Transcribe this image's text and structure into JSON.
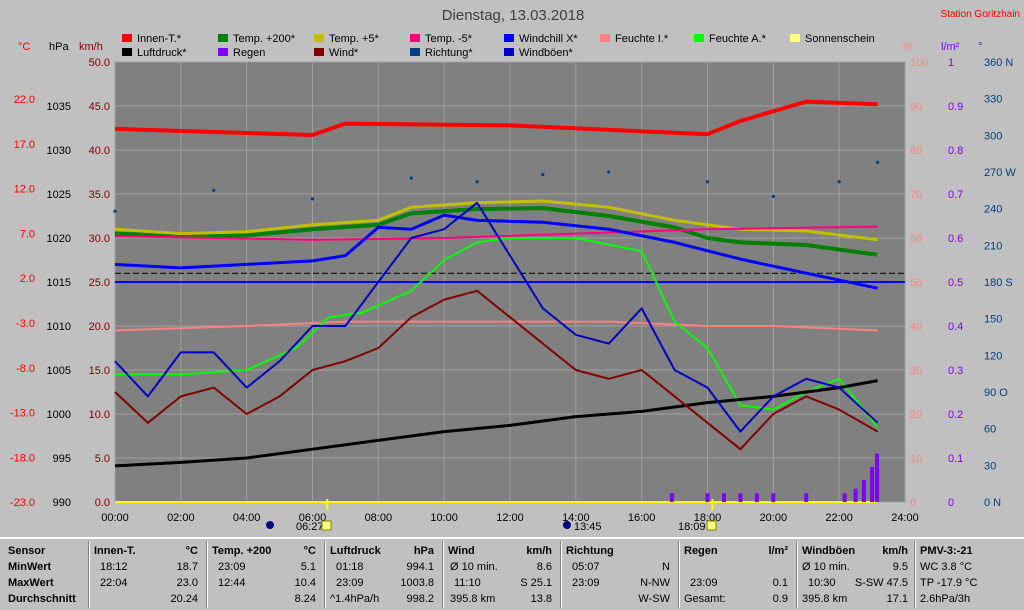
{
  "header": {
    "title": "Dienstag, 13.03.2018",
    "station": "Station Goritzhain"
  },
  "legend": [
    {
      "label": "Innen-T.*",
      "color": "#ff0000"
    },
    {
      "label": "Temp. +200*",
      "color": "#008000"
    },
    {
      "label": "Temp. +5*",
      "color": "#c0c000"
    },
    {
      "label": "Temp. -5*",
      "color": "#ff0080"
    },
    {
      "label": "Windchill X*",
      "color": "#0000ff"
    },
    {
      "label": "Feuchte I.*",
      "color": "#ff8080"
    },
    {
      "label": "Feuchte A.*",
      "color": "#00ff00"
    },
    {
      "label": "Sonnenschein",
      "color": "#ffff80"
    },
    {
      "label": "Luftdruck*",
      "color": "#000000"
    },
    {
      "label": "Regen",
      "color": "#8000ff"
    },
    {
      "label": "Wind*",
      "color": "#800000"
    },
    {
      "label": "Richtung*",
      "color": "#004080"
    },
    {
      "label": "Windböen*",
      "color": "#0000c0"
    }
  ],
  "axes": {
    "celsius": {
      "unit": "°C",
      "ticks": [
        "22.0",
        "17.0",
        "12.0",
        "7.0",
        "2.0",
        "-3.0",
        "-8.0",
        "-13.0",
        "-18.0",
        "-23.0"
      ],
      "color": "#ff0000"
    },
    "hpa": {
      "unit": "hPa",
      "ticks": [
        "1035",
        "1030",
        "1025",
        "1020",
        "1015",
        "1010",
        "1005",
        "1000",
        "995",
        "990"
      ],
      "color": "#000000"
    },
    "kmh": {
      "unit": "km/h",
      "ticks": [
        "50.0",
        "45.0",
        "40.0",
        "35.0",
        "30.0",
        "25.0",
        "20.0",
        "15.0",
        "10.0",
        "5.0",
        "0.0"
      ],
      "color": "#800000"
    },
    "percent": {
      "unit": "%",
      "ticks": [
        "100",
        "90",
        "80",
        "70",
        "60",
        "50",
        "40",
        "30",
        "20",
        "10",
        "0"
      ],
      "color": "#ff8080"
    },
    "lm2": {
      "unit": "l/m²",
      "ticks": [
        "1",
        "0.9",
        "0.8",
        "0.7",
        "0.6",
        "0.5",
        "0.4",
        "0.3",
        "0.2",
        "0.1",
        "0"
      ],
      "color": "#8000ff"
    },
    "deg": {
      "unit": "°",
      "ticks": [
        "360 N",
        "330",
        "300",
        "270 W",
        "240",
        "210",
        "180 S",
        "150",
        "120",
        "90 O",
        "60",
        "30",
        "0 N"
      ],
      "color": "#004080"
    },
    "time": {
      "ticks": [
        "00:00",
        "02:00",
        "04:00",
        "06:00",
        "08:00",
        "10:00",
        "12:00",
        "14:00",
        "16:00",
        "18:00",
        "20:00",
        "22:00",
        "24:00"
      ]
    }
  },
  "sun_markers": {
    "sunrise_time": "06:27",
    "moon_time": "13:45",
    "sunset_time": "18:09"
  },
  "chart_data": {
    "type": "line",
    "title": "Dienstag, 13.03.2018",
    "x_label": "",
    "x_range": [
      "00:00",
      "24:00"
    ],
    "series": [
      {
        "name": "Innen-T.*",
        "axis": "°C",
        "x": [
          "00:00",
          "06:00",
          "07:00",
          "12:00",
          "18:00",
          "19:00",
          "21:00",
          "23:10"
        ],
        "values": [
          19.4,
          18.7,
          20.0,
          19.8,
          18.8,
          20.3,
          22.5,
          22.2
        ]
      },
      {
        "name": "Temp. +200*",
        "axis": "°C",
        "x": [
          "00:00",
          "02:00",
          "04:00",
          "06:00",
          "08:00",
          "09:00",
          "11:00",
          "13:00",
          "15:00",
          "17:00",
          "18:00",
          "19:00",
          "21:00",
          "23:09"
        ],
        "values": [
          7.5,
          7.2,
          7.3,
          8.0,
          8.5,
          9.8,
          10.3,
          10.4,
          9.5,
          8.2,
          7.0,
          6.5,
          6.2,
          5.1
        ]
      },
      {
        "name": "Temp. +5*",
        "axis": "°C",
        "x": [
          "00:00",
          "02:00",
          "04:00",
          "06:00",
          "08:00",
          "09:00",
          "11:00",
          "13:00",
          "15:00",
          "17:00",
          "19:00",
          "21:00",
          "23:10"
        ],
        "values": [
          8.0,
          7.5,
          7.7,
          8.5,
          9.0,
          10.5,
          11.0,
          11.2,
          10.5,
          9.0,
          8.0,
          7.8,
          6.8
        ]
      },
      {
        "name": "Temp. -5*",
        "axis": "°C",
        "x": [
          "00:00",
          "06:00",
          "10:00",
          "14:00",
          "18:00",
          "23:10"
        ],
        "values": [
          7.2,
          6.8,
          7.0,
          7.5,
          8.0,
          8.3
        ]
      },
      {
        "name": "Windchill X*",
        "axis": "°C",
        "x": [
          "00:00",
          "02:00",
          "04:00",
          "06:00",
          "07:00",
          "08:00",
          "09:00",
          "10:00",
          "11:00",
          "13:00",
          "15:00",
          "17:00",
          "19:00",
          "21:00",
          "23:10"
        ],
        "values": [
          4.0,
          3.6,
          4.0,
          4.4,
          5.0,
          8.2,
          8.0,
          9.6,
          9.0,
          8.8,
          8.0,
          6.5,
          4.6,
          3.0,
          1.3
        ]
      },
      {
        "name": "Feuchte I.*",
        "axis": "%",
        "x": [
          "00:00",
          "04:00",
          "07:00",
          "10:00",
          "15:00",
          "18:00",
          "20:00",
          "23:10"
        ],
        "values": [
          39,
          40,
          41,
          41,
          41,
          40,
          40,
          39
        ]
      },
      {
        "name": "Feuchte A.*",
        "axis": "%",
        "x": [
          "00:00",
          "02:00",
          "04:00",
          "05:30",
          "06:30",
          "07:30",
          "09:00",
          "10:00",
          "11:00",
          "12:00",
          "14:00",
          "16:00",
          "17:00",
          "18:00",
          "19:00",
          "20:00",
          "21:00",
          "22:00",
          "23:10"
        ],
        "values": [
          29,
          29,
          30,
          35,
          42,
          43,
          48,
          55,
          59,
          60,
          60,
          57,
          41,
          35,
          22,
          21,
          25,
          28,
          17
        ]
      },
      {
        "name": "Luftdruck*",
        "axis": "hPa",
        "x": [
          "00:00",
          "02:00",
          "04:00",
          "06:00",
          "08:00",
          "10:00",
          "12:00",
          "14:00",
          "16:00",
          "18:00",
          "20:00",
          "22:00",
          "23:10"
        ],
        "values": [
          994.1,
          994.5,
          995.0,
          996.0,
          997.0,
          998.0,
          998.7,
          999.7,
          1000.3,
          1001.3,
          1002.0,
          1003.0,
          1003.8
        ]
      },
      {
        "name": "Wind*",
        "axis": "km/h",
        "x": [
          "00:00",
          "01:00",
          "02:00",
          "03:00",
          "04:00",
          "05:00",
          "06:00",
          "07:00",
          "08:00",
          "09:00",
          "10:00",
          "11:00",
          "12:00",
          "13:00",
          "14:00",
          "15:00",
          "16:00",
          "17:00",
          "18:00",
          "19:00",
          "20:00",
          "21:00",
          "22:00",
          "23:10"
        ],
        "values": [
          12.5,
          9.0,
          12.0,
          13.0,
          10.0,
          12.0,
          15.0,
          16.0,
          17.5,
          21.0,
          23.0,
          24.0,
          21.0,
          18.0,
          15.0,
          14.0,
          15.0,
          12.0,
          9.0,
          6.0,
          10.0,
          12.0,
          10.5,
          8.0
        ]
      },
      {
        "name": "Windböen*",
        "axis": "km/h",
        "x": [
          "00:00",
          "01:00",
          "02:00",
          "03:00",
          "04:00",
          "05:00",
          "06:00",
          "07:00",
          "08:00",
          "09:00",
          "10:00",
          "11:00",
          "12:00",
          "13:00",
          "14:00",
          "15:00",
          "16:00",
          "17:00",
          "18:00",
          "19:00",
          "20:00",
          "21:00",
          "22:00",
          "23:10"
        ],
        "values": [
          16.0,
          12.0,
          17.0,
          17.0,
          13.0,
          16.0,
          20.0,
          20.0,
          25.0,
          30.0,
          31.0,
          34.0,
          28.0,
          22.0,
          19.0,
          18.0,
          22.0,
          15.0,
          13.0,
          8.0,
          12.0,
          14.0,
          13.0,
          9.0
        ]
      },
      {
        "name": "Richtung*",
        "axis": "°",
        "x": [
          "00:00",
          "03:00",
          "06:00",
          "09:00",
          "11:00",
          "13:00",
          "15:00",
          "18:00",
          "20:00",
          "22:00",
          "23:10"
        ],
        "values": [
          238,
          255,
          248,
          265,
          262,
          268,
          270,
          262,
          250,
          262,
          278
        ]
      },
      {
        "name": "Regen",
        "axis": "l/m²",
        "x": [
          "16:55",
          "18:00",
          "18:30",
          "19:00",
          "19:30",
          "20:00",
          "21:00",
          "22:10",
          "22:30",
          "22:45",
          "23:00",
          "23:09"
        ],
        "values": [
          0.02,
          0.02,
          0.02,
          0.02,
          0.02,
          0.02,
          0.02,
          0.02,
          0.03,
          0.05,
          0.08,
          0.11
        ]
      }
    ],
    "reference_lines": [
      {
        "value": 2.0,
        "axis": "°C",
        "color": "#0000ff",
        "style": "solid"
      },
      {
        "value": 3.0,
        "axis": "°C",
        "color": "#000000",
        "style": "dashed"
      }
    ]
  },
  "stats": {
    "sensor": {
      "label": "Sensor",
      "min": "MinWert",
      "max": "MaxWert",
      "avg": "Durchschnitt"
    },
    "innen": {
      "title": "Innen-T.",
      "unit": "°C",
      "min_time": "18:12",
      "min_val": "18.7",
      "max_time": "22:04",
      "max_val": "23.0",
      "avg": "20.24"
    },
    "temp": {
      "title": "Temp. +200",
      "unit": "°C",
      "min_time": "23:09",
      "min_val": "5.1",
      "max_time": "12:44",
      "max_val": "10.4",
      "avg": "8.24"
    },
    "druck": {
      "title": "Luftdruck",
      "unit": "hPa",
      "min_time": "01:18",
      "min_val": "994.1",
      "max_time": "23:09",
      "max_val": "1003.8",
      "avg_label": "^1.4hPa/h",
      "avg": "998.2"
    },
    "wind": {
      "title": "Wind",
      "unit": "km/h",
      "min_label": "Ø 10 min.",
      "min_val": "8.6",
      "max_time": "11:10",
      "max_val": "S 25.1",
      "avg_label": "395.8 km",
      "avg": "13.8"
    },
    "richtung": {
      "title": "Richtung",
      "min_time": "05:07",
      "min_val": "N",
      "max_time": "23:09",
      "max_val": "N-NW",
      "avg": "W-SW"
    },
    "regen": {
      "title": "Regen",
      "unit": "l/m²",
      "max_time": "23:09",
      "max_val": "0.1",
      "avg_label": "Gesamt:",
      "avg": "0.9"
    },
    "boeen": {
      "title": "Windböen",
      "unit": "km/h",
      "min_label": "Ø 10 min.",
      "min_val": "9.5",
      "max_time": "10:30",
      "max_val": "S-SW 47.5",
      "avg_label": "395.8 km",
      "avg": "17.1"
    },
    "pmv": {
      "title": "PMV-3:-21",
      "min_val": "WC 3.8 °C",
      "max_val": "TP -17.9 °C",
      "avg": "2.6hPa/3h"
    }
  }
}
